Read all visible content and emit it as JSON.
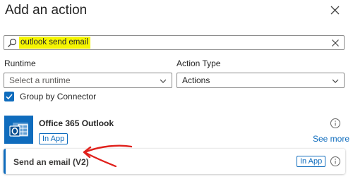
{
  "panel": {
    "title": "Add an action",
    "close_icon": "close-icon"
  },
  "search": {
    "value": "outlook send email",
    "highlight_color": "#f5f500",
    "search_icon": "search-icon",
    "clear_icon": "clear-icon"
  },
  "filters": {
    "runtime": {
      "label": "Runtime",
      "placeholder": "Select a runtime"
    },
    "action_type": {
      "label": "Action Type",
      "value": "Actions"
    }
  },
  "group_by_connector": {
    "label": "Group by Connector",
    "checked": true
  },
  "connector": {
    "name": "Office 365 Outlook",
    "badge": "In App",
    "see_more": "See more",
    "logo_icon": "outlook-logo-icon"
  },
  "actions": [
    {
      "name": "Send an email (V2)",
      "badge": "In App",
      "highlighted": true
    }
  ],
  "annotation": {
    "type": "red-hand-drawn-arrow",
    "color": "#e0201b"
  },
  "colors": {
    "accent": "#0f6cbd",
    "text": "#242424"
  }
}
